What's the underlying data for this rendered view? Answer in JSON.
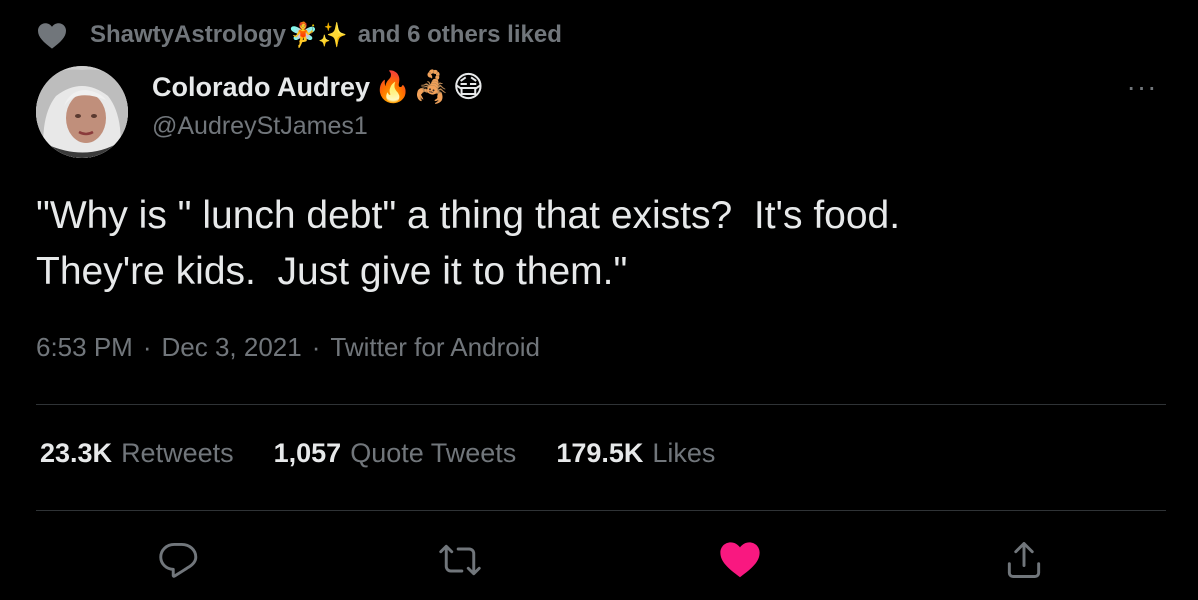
{
  "liked_by": {
    "name": "ShawtyAstrology",
    "emojis": "🧚✨",
    "suffix": "and 6 others liked"
  },
  "author": {
    "display_name": "Colorado Audrey",
    "emojis": "🔥🦂😷",
    "handle": "@AudreyStJames1"
  },
  "tweet": {
    "text": "\"Why is \" lunch debt\" a thing that exists?  It's food.\nThey're kids.  Just give it to them.\"",
    "time": "6:53 PM",
    "date": "Dec 3, 2021",
    "source": "Twitter for Android",
    "separator": "·"
  },
  "stats": {
    "retweets": {
      "count": "23.3K",
      "label": "Retweets"
    },
    "quotes": {
      "count": "1,057",
      "label": "Quote Tweets"
    },
    "likes": {
      "count": "179.5K",
      "label": "Likes"
    }
  },
  "more_label": "···",
  "colors": {
    "background": "#000000",
    "text_primary": "#e7e9ea",
    "text_secondary": "#71767b",
    "divider": "#2f3336",
    "like_pink": "#f91880"
  },
  "icons": {
    "liked_header": "heart-icon",
    "reply": "reply-icon",
    "retweet": "retweet-icon",
    "like": "heart-filled-icon",
    "share": "share-icon",
    "more": "more-icon"
  }
}
